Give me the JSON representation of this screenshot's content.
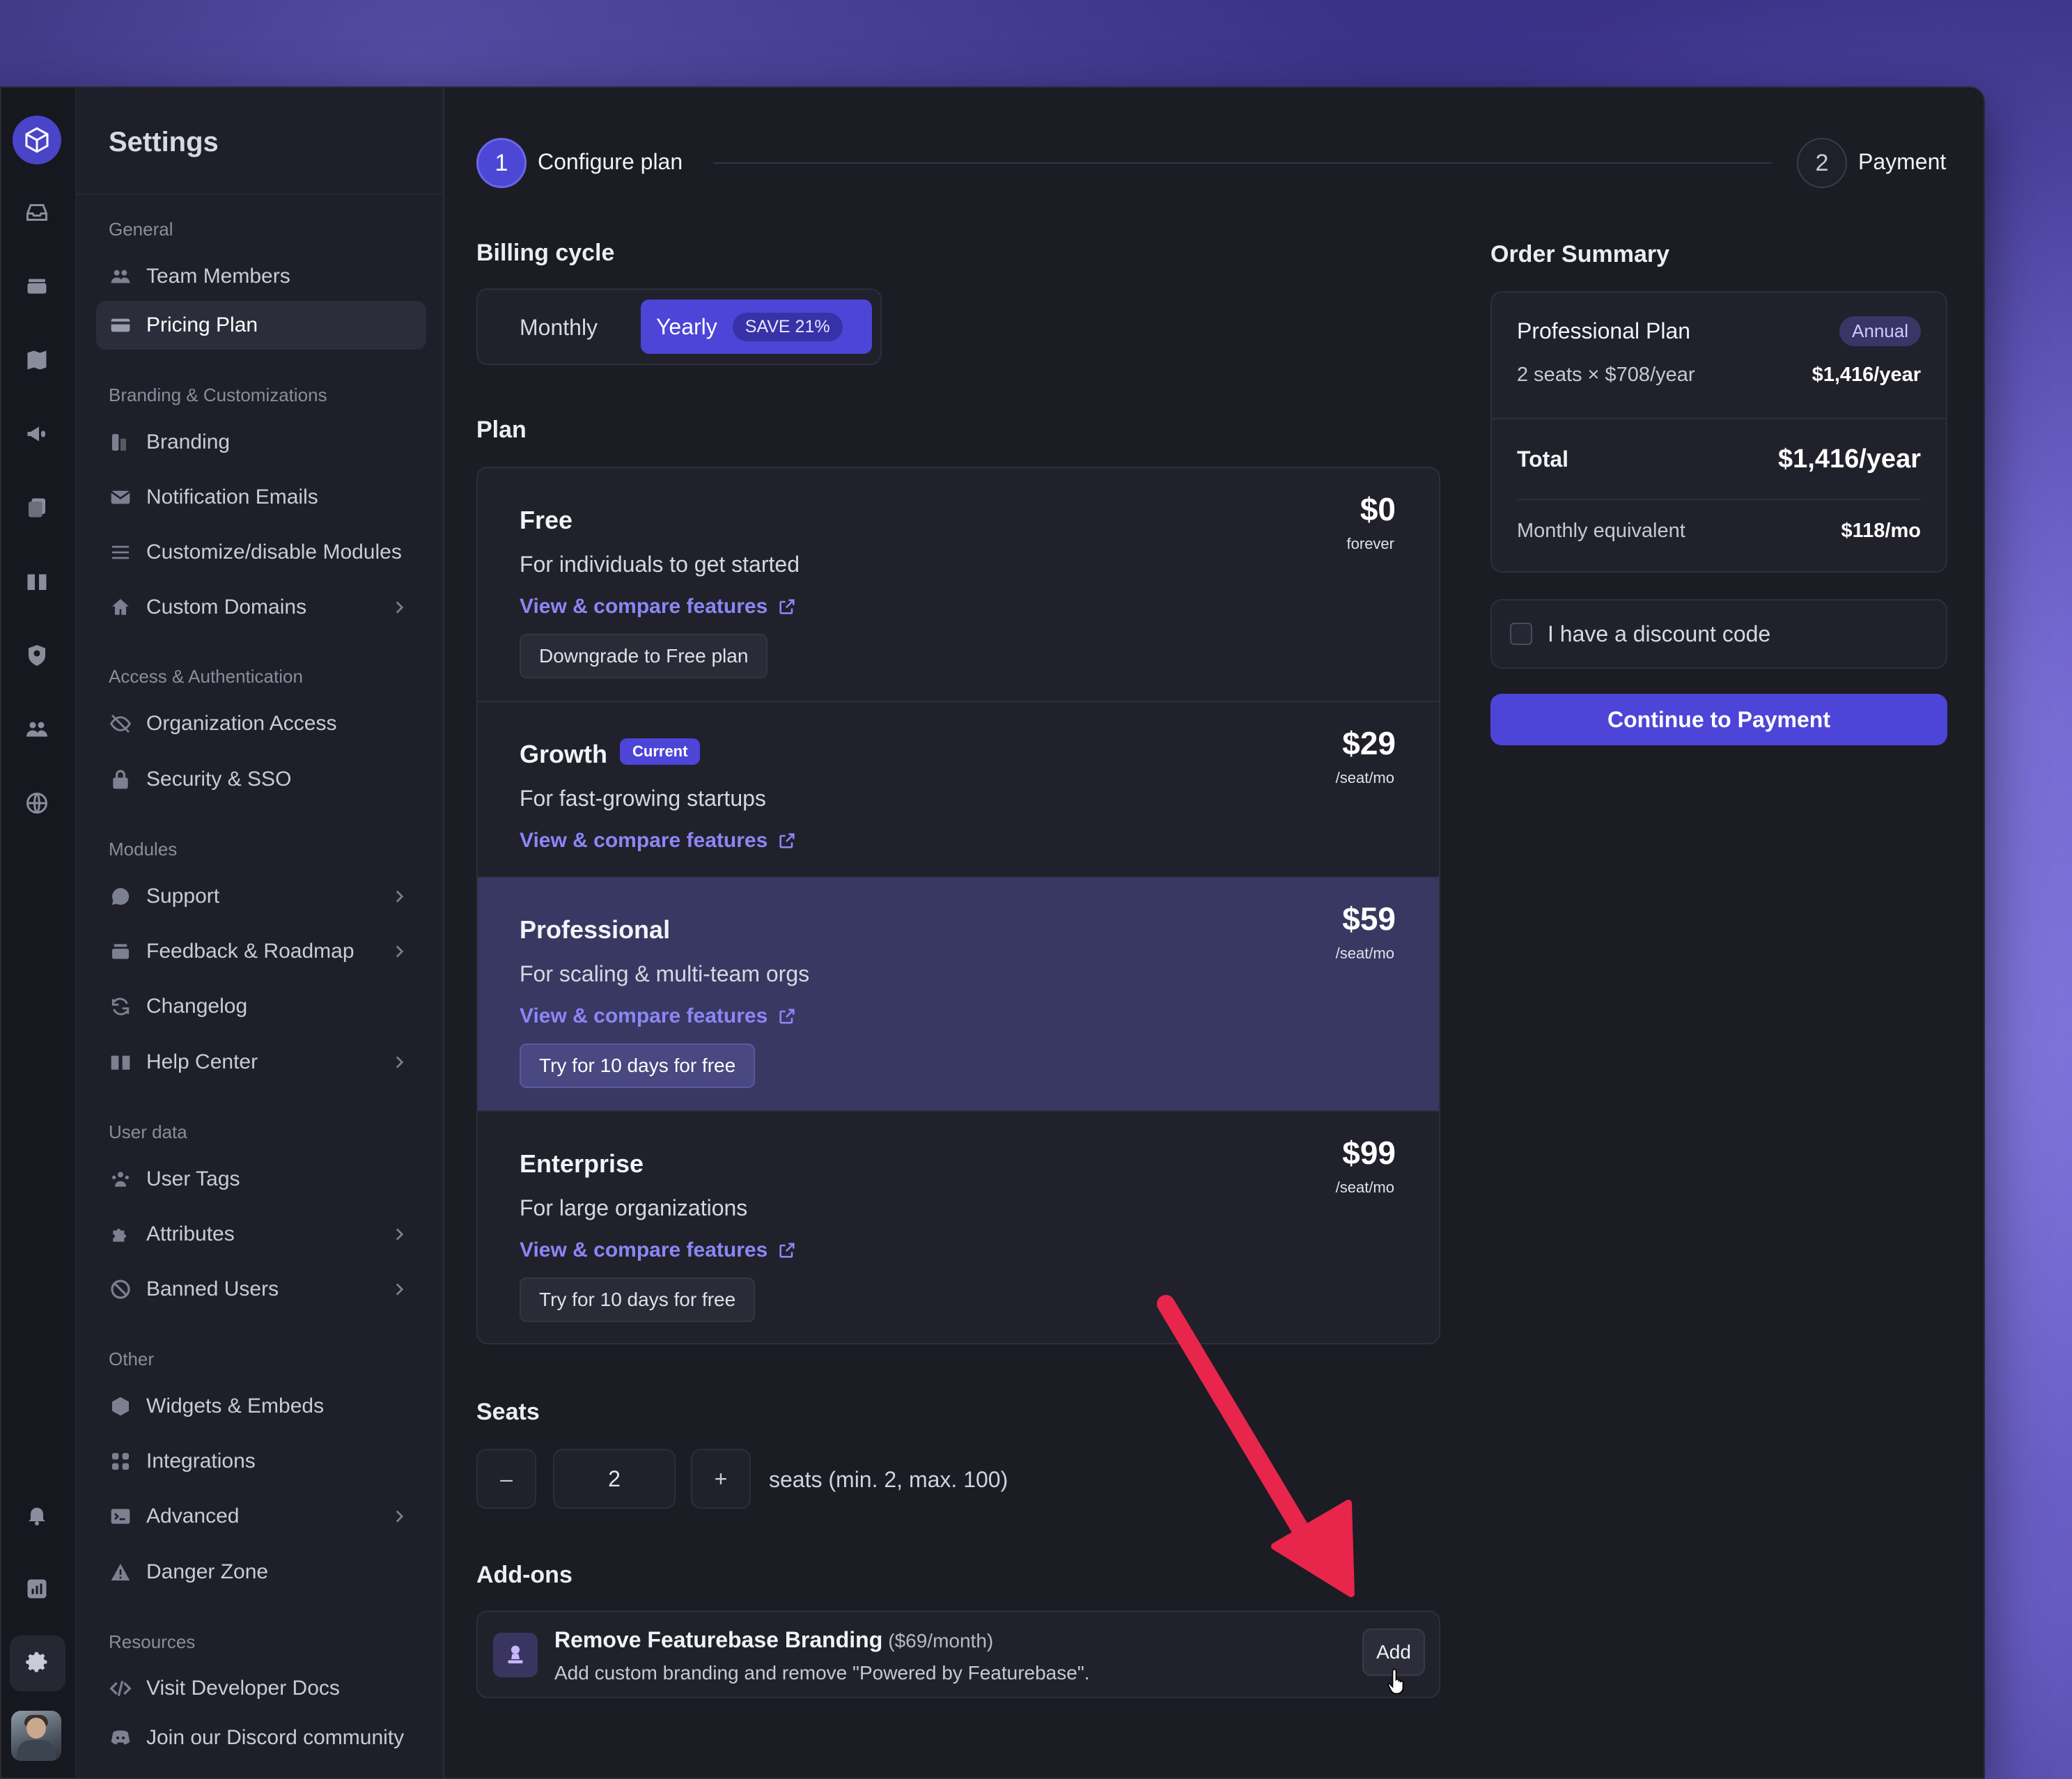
{
  "settings_title": "Settings",
  "sidebar": {
    "groups": {
      "general": "General",
      "branding": "Branding & Customizations",
      "access": "Access & Authentication",
      "modules": "Modules",
      "user_data": "User data",
      "other": "Other",
      "resources": "Resources"
    },
    "items": {
      "team_members": "Team Members",
      "pricing_plan": "Pricing Plan",
      "branding": "Branding",
      "notification_emails": "Notification Emails",
      "customize_modules": "Customize/disable Modules",
      "custom_domains": "Custom Domains",
      "organization_access": "Organization Access",
      "security_sso": "Security & SSO",
      "support": "Support",
      "feedback_roadmap": "Feedback & Roadmap",
      "changelog": "Changelog",
      "help_center": "Help Center",
      "user_tags": "User Tags",
      "attributes": "Attributes",
      "banned_users": "Banned Users",
      "widgets_embeds": "Widgets & Embeds",
      "integrations": "Integrations",
      "advanced": "Advanced",
      "danger_zone": "Danger Zone",
      "developer_docs": "Visit Developer Docs",
      "discord": "Join our Discord community"
    }
  },
  "steps": [
    {
      "number": "1",
      "label": "Configure plan"
    },
    {
      "number": "2",
      "label": "Payment"
    }
  ],
  "billing": {
    "heading": "Billing cycle",
    "monthly": "Monthly",
    "yearly": "Yearly",
    "save_badge": "SAVE 21%",
    "selected": "Yearly"
  },
  "plan_heading": "Plan",
  "plans": {
    "free": {
      "name": "Free",
      "desc": "For individuals to get started",
      "link": "View & compare features",
      "button": "Downgrade to Free plan",
      "price": "$0",
      "unit": "forever"
    },
    "growth": {
      "name": "Growth",
      "badge": "Current",
      "desc": "For fast-growing startups",
      "link": "View & compare features",
      "price": "$29",
      "unit": "/seat/mo"
    },
    "professional": {
      "name": "Professional",
      "desc": "For scaling & multi-team orgs",
      "link": "View & compare features",
      "button": "Try for 10 days for free",
      "price": "$59",
      "unit": "/seat/mo"
    },
    "enterprise": {
      "name": "Enterprise",
      "desc": "For large organizations",
      "link": "View & compare features",
      "button": "Try for 10 days for free",
      "price": "$99",
      "unit": "/seat/mo"
    }
  },
  "seats": {
    "heading": "Seats",
    "minus": "–",
    "plus": "+",
    "value": "2",
    "hint": "seats (min. 2, max. 100)"
  },
  "addons": {
    "heading": "Add-ons",
    "items": [
      {
        "title": "Remove Featurebase Branding",
        "price": "($69/month)",
        "desc": "Add custom branding and remove \"Powered by Featurebase\".",
        "button": "Add"
      }
    ]
  },
  "summary": {
    "heading": "Order Summary",
    "plan_name": "Professional Plan",
    "plan_badge": "Annual",
    "seats_line": "2 seats × $708/year",
    "seats_amount": "$1,416/year",
    "total_label": "Total",
    "total_amount": "$1,416/year",
    "monthly_label": "Monthly equivalent",
    "monthly_amount": "$118/mo",
    "discount_label": "I have a discount code",
    "continue_label": "Continue to Payment"
  },
  "colors": {
    "accent": "#4c45d8",
    "link": "#8c86f5",
    "annotation_arrow": "#e8254a"
  }
}
